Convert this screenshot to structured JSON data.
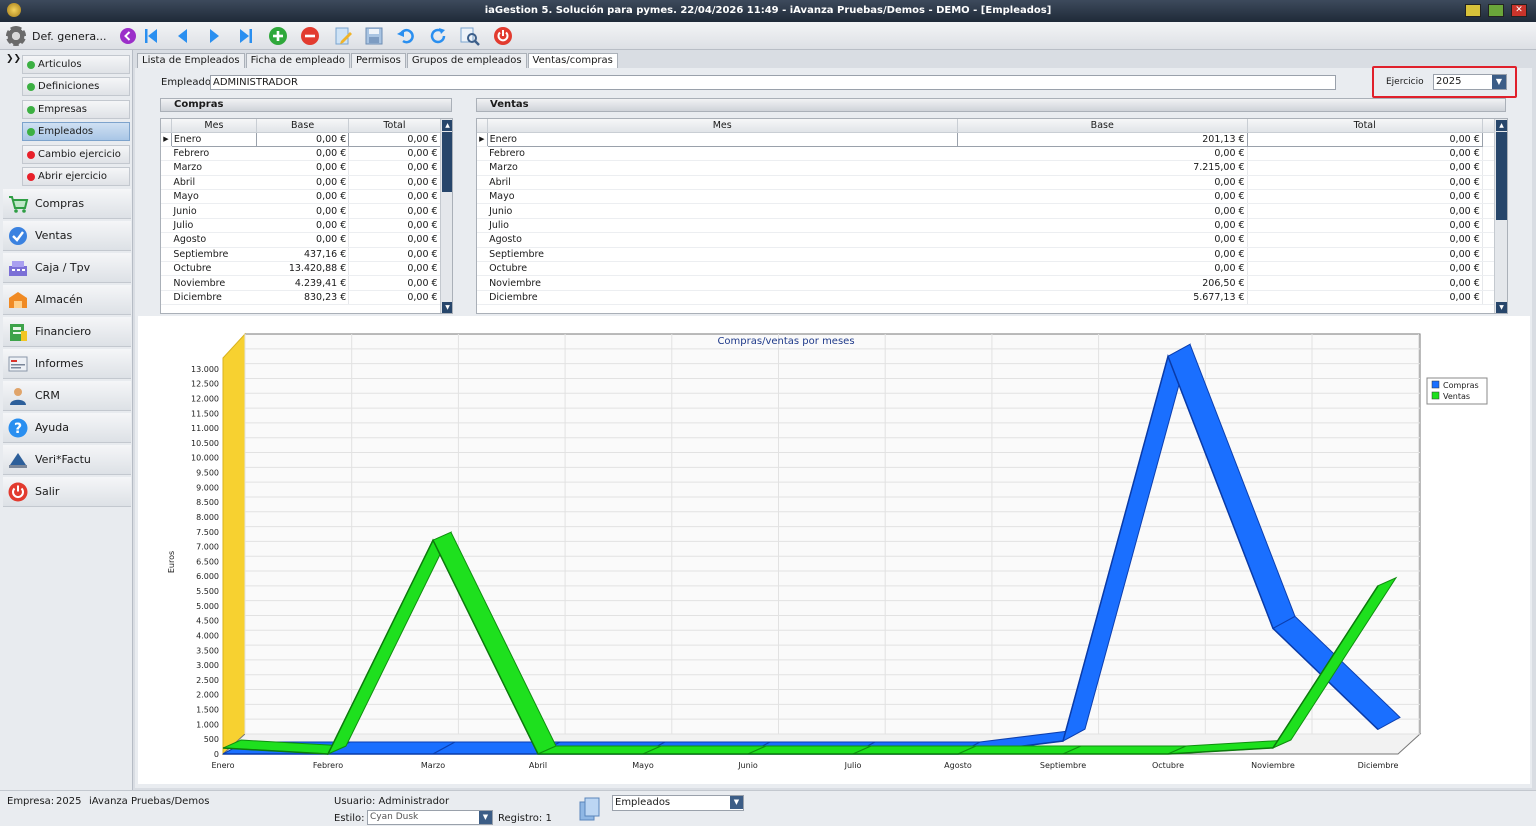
{
  "window": {
    "title": "iaGestion 5. Solución para pymes.   22/04/2026 11:49   -   iAvanza Pruebas/Demos - DEMO - [Empleados]"
  },
  "toolbar": {
    "def_label": "Def. genera...",
    "buttons": [
      "first-icon",
      "prev-icon",
      "next-icon",
      "last-icon",
      "add-icon",
      "delete-icon",
      "edit-icon",
      "save-icon",
      "undo-icon",
      "refresh-icon",
      "search-icon",
      "power-icon"
    ]
  },
  "sidebar": {
    "subitems": [
      {
        "label": "Articulos",
        "dot": "#3cb043"
      },
      {
        "label": "Definiciones",
        "dot": "#3cb043"
      },
      {
        "label": "Empresas",
        "dot": "#3cb043"
      },
      {
        "label": "Empleados",
        "dot": "#3cb043"
      },
      {
        "label": "Cambio ejercicio",
        "dot": "#e8202a"
      },
      {
        "label": "Abrir ejercicio",
        "dot": "#e8202a"
      }
    ],
    "items": [
      {
        "label": "Compras",
        "icon": "cart-icon"
      },
      {
        "label": "Ventas",
        "icon": "ventas-icon"
      },
      {
        "label": "Caja / Tpv",
        "icon": "register-icon"
      },
      {
        "label": "Almacén",
        "icon": "warehouse-icon"
      },
      {
        "label": "Financiero",
        "icon": "finance-icon"
      },
      {
        "label": "Informes",
        "icon": "reports-icon"
      },
      {
        "label": "CRM",
        "icon": "crm-icon"
      },
      {
        "label": "Ayuda",
        "icon": "help-icon"
      },
      {
        "label": "Veri*Factu",
        "icon": "verifactu-icon"
      },
      {
        "label": "Salir",
        "icon": "exit-icon"
      }
    ]
  },
  "tabs": [
    "Lista de Empleados",
    "Ficha de empleado",
    "Permisos",
    "Grupos de empleados",
    "Ventas/compras"
  ],
  "form": {
    "empleado_label": "Empleado",
    "empleado_value": "ADMINISTRADOR",
    "ejercicio_label": "Ejercicio",
    "ejercicio_value": "2025"
  },
  "compras": {
    "title": "Compras",
    "columns": [
      "Mes",
      "Base",
      "Total"
    ],
    "rows": [
      [
        "Enero",
        "0,00 €",
        "0,00 €"
      ],
      [
        "Febrero",
        "0,00 €",
        "0,00 €"
      ],
      [
        "Marzo",
        "0,00 €",
        "0,00 €"
      ],
      [
        "Abril",
        "0,00 €",
        "0,00 €"
      ],
      [
        "Mayo",
        "0,00 €",
        "0,00 €"
      ],
      [
        "Junio",
        "0,00 €",
        "0,00 €"
      ],
      [
        "Julio",
        "0,00 €",
        "0,00 €"
      ],
      [
        "Agosto",
        "0,00 €",
        "0,00 €"
      ],
      [
        "Septiembre",
        "437,16 €",
        "0,00 €"
      ],
      [
        "Octubre",
        "13.420,88 €",
        "0,00 €"
      ],
      [
        "Noviembre",
        "4.239,41 €",
        "0,00 €"
      ],
      [
        "Diciembre",
        "830,23 €",
        "0,00 €"
      ]
    ]
  },
  "ventas": {
    "title": "Ventas",
    "columns": [
      "Mes",
      "Base",
      "Total"
    ],
    "rows": [
      [
        "Enero",
        "201,13 €",
        "0,00 €"
      ],
      [
        "Febrero",
        "0,00 €",
        "0,00 €"
      ],
      [
        "Marzo",
        "7.215,00 €",
        "0,00 €"
      ],
      [
        "Abril",
        "0,00 €",
        "0,00 €"
      ],
      [
        "Mayo",
        "0,00 €",
        "0,00 €"
      ],
      [
        "Junio",
        "0,00 €",
        "0,00 €"
      ],
      [
        "Julio",
        "0,00 €",
        "0,00 €"
      ],
      [
        "Agosto",
        "0,00 €",
        "0,00 €"
      ],
      [
        "Septiembre",
        "0,00 €",
        "0,00 €"
      ],
      [
        "Octubre",
        "0,00 €",
        "0,00 €"
      ],
      [
        "Noviembre",
        "206,50 €",
        "0,00 €"
      ],
      [
        "Diciembre",
        "5.677,13 €",
        "0,00 €"
      ]
    ]
  },
  "chart_data": {
    "type": "line",
    "title": "Compras/ventas por meses",
    "xlabel": "",
    "ylabel": "Euros",
    "categories": [
      "Enero",
      "Febrero",
      "Marzo",
      "Abril",
      "Mayo",
      "Junio",
      "Julio",
      "Agosto",
      "Septiembre",
      "Octubre",
      "Noviembre",
      "Diciembre"
    ],
    "series": [
      {
        "name": "Compras",
        "color": "#1a6fff",
        "values": [
          0,
          0,
          0,
          0,
          0,
          0,
          0,
          0,
          437.16,
          13420.88,
          4239.41,
          830.23
        ]
      },
      {
        "name": "Ventas",
        "color": "#1ee01e",
        "values": [
          201.13,
          0,
          7215.0,
          0,
          0,
          0,
          0,
          0,
          0,
          0,
          206.5,
          5677.13
        ]
      }
    ],
    "yticks": [
      "0",
      "500",
      "1.000",
      "1.500",
      "2.000",
      "2.500",
      "3.000",
      "3.500",
      "4.000",
      "4.500",
      "5.000",
      "5.500",
      "6.000",
      "6.500",
      "7.000",
      "7.500",
      "8.000",
      "8.500",
      "9.000",
      "9.500",
      "10.000",
      "10.500",
      "11.000",
      "11.500",
      "12.000",
      "12.500",
      "13.000"
    ],
    "ylim": [
      0,
      13500
    ],
    "legend": "top-right",
    "grid": true
  },
  "status": {
    "empresa_label": "Empresa:",
    "empresa_year": "2025",
    "empresa_name": "iAvanza Pruebas/Demos",
    "usuario": "Usuario: Administrador",
    "estilo_label": "Estilo:",
    "estilo_value": "Cyan Dusk",
    "registro": "Registro:  1",
    "modulo": "Empleados"
  }
}
